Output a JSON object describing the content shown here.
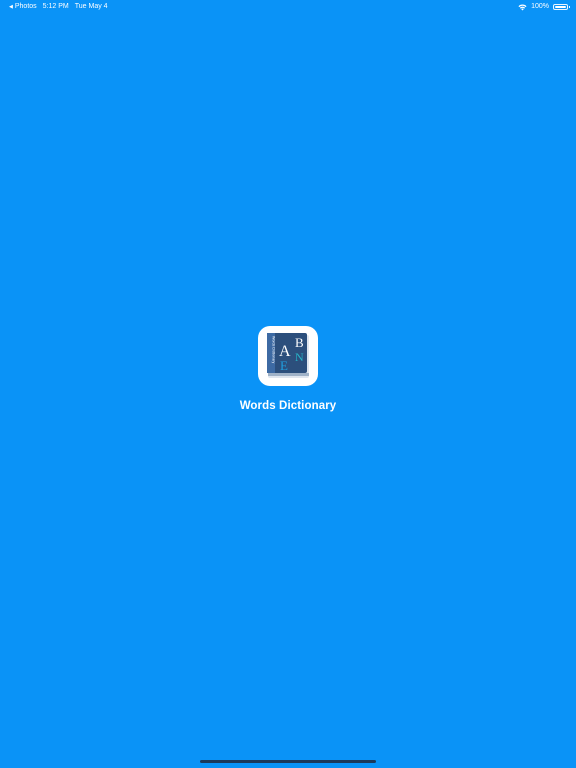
{
  "colors": {
    "background": "#0a93f7",
    "text": "#ffffff",
    "book_cover": "#2c4f7c",
    "home_indicator": "#1c3a5c"
  },
  "status_bar": {
    "back_app": "Photos",
    "time": "5:12 PM",
    "date": "Tue May 4",
    "battery": "100%",
    "icons": [
      "back-caret-icon",
      "wifi-icon",
      "battery-icon"
    ]
  },
  "app": {
    "name": "Words Dictionary",
    "icon": "book-dictionary-icon",
    "icon_letters": [
      "A",
      "B",
      "E",
      "N"
    ],
    "spine_text": "Words Dictionary"
  }
}
